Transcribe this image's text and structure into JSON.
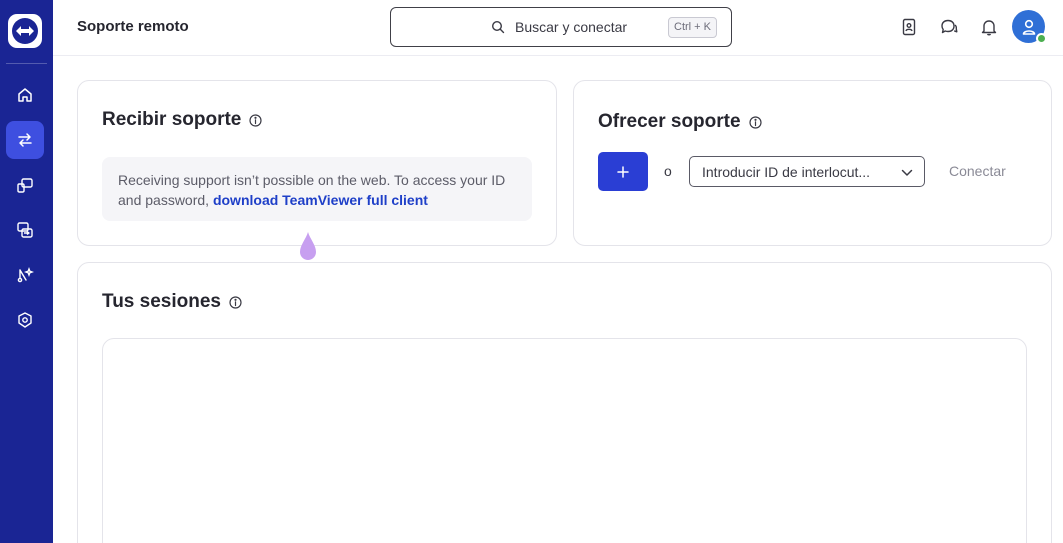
{
  "topbar": {
    "title": "Soporte remoto",
    "search_label": "Buscar y conectar",
    "search_shortcut": "Ctrl + K"
  },
  "sidebar": {
    "items": [
      {
        "name": "home-icon",
        "active": false
      },
      {
        "name": "remote-support-icon",
        "active": true
      },
      {
        "name": "devices-icon",
        "active": false
      },
      {
        "name": "sessions-icon",
        "active": false
      },
      {
        "name": "integrations-icon",
        "active": false
      },
      {
        "name": "security-settings-icon",
        "active": false
      }
    ]
  },
  "receive": {
    "title": "Recibir soporte",
    "notice_text": "Receiving support isn’t possible on the web. To access your ID and password, ",
    "notice_link": "download TeamViewer full client"
  },
  "offer": {
    "title": "Ofrecer soporte",
    "plus_label": "+",
    "or_label": "o",
    "id_placeholder": "Introducir ID de interlocut...",
    "connect_label": "Conectar"
  },
  "sessions": {
    "title": "Tus sesiones"
  },
  "colors": {
    "sidebar": "#1a2594",
    "accent": "#2a3ed4",
    "link": "#1e3fc8",
    "status_online": "#4caf50"
  }
}
